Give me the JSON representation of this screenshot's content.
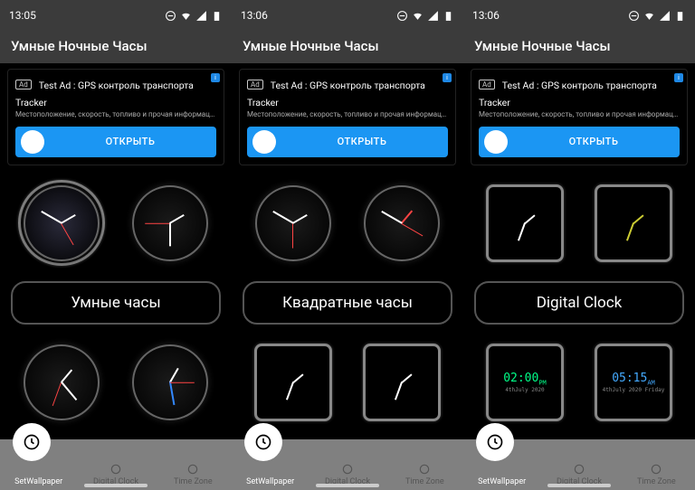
{
  "screens": [
    {
      "time": "13:05",
      "title": "Умные Ночные Часы",
      "ad": {
        "badge": "Ad",
        "title": "Test Ad : GPS контроль транспорта Tracker",
        "desc": "Местоположение, скорость, топливо и прочая информация о вашей…",
        "cta": "ОТКРЫТЬ"
      },
      "section_label": "Умные часы",
      "row1_style": [
        "round-dark-red",
        "round-dark"
      ],
      "row2_style": [
        "round-roman-white",
        "round-numbers"
      ]
    },
    {
      "time": "13:06",
      "title": "Умные Ночные Часы",
      "ad": {
        "badge": "Ad",
        "title": "Test Ad : GPS контроль транспорта Tracker",
        "desc": "Местоположение, скорость, топливо и прочая информация о вашей…",
        "cta": "ОТКРЫТЬ"
      },
      "section_label": "Квадратные часы",
      "row1_style": [
        "round-dark",
        "round-dark-red2"
      ],
      "row2_style": [
        "square-analog",
        "square-analog"
      ]
    },
    {
      "time": "13:06",
      "title": "Умные Ночные Часы",
      "ad": {
        "badge": "Ad",
        "title": "Test Ad : GPS контроль транспорта Tracker",
        "desc": "Местоположение, скорость, топливо и прочая информация о вашей…",
        "cta": "ОТКРЫТЬ"
      },
      "section_label": "Digital Clock",
      "row1_style": [
        "square-analog",
        "square-roman-yellow"
      ],
      "row2_style": [
        "digital-green",
        "digital-blue"
      ],
      "digital1": {
        "time": "02:00",
        "ampm": "PM",
        "date": "4thJuly 2020"
      },
      "digital2": {
        "time": "05:15",
        "ampm": "AM",
        "date": "4thJuly 2020 Friday"
      }
    }
  ],
  "nav": {
    "item1": "SetWallpaper",
    "item2": "Digital Clock",
    "item3": "Time Zone"
  }
}
